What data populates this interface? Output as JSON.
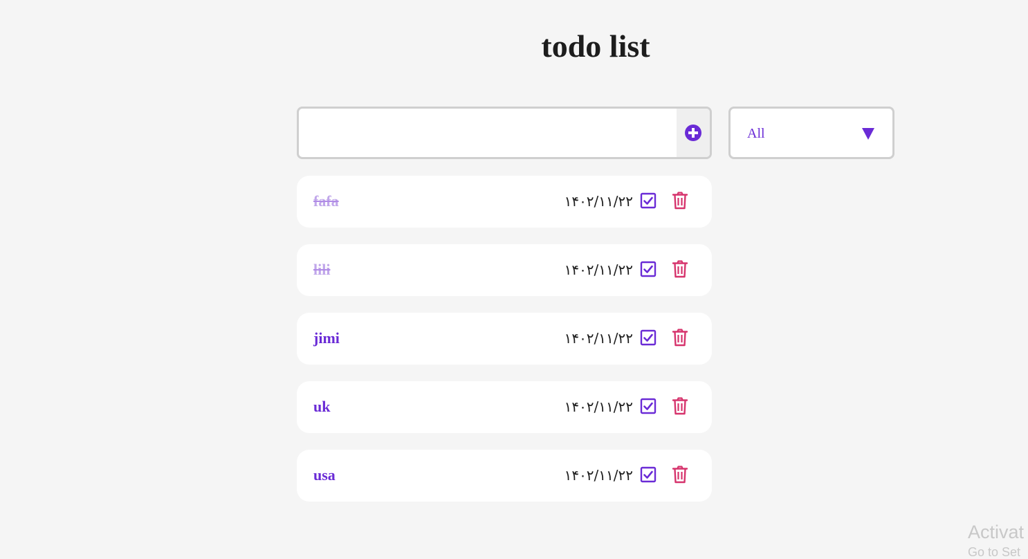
{
  "app": {
    "title": "todo list"
  },
  "form": {
    "input_value": "",
    "input_placeholder": "",
    "add_icon": "plus-circle-icon"
  },
  "filter": {
    "selected": "All",
    "icon": "triangle-down-icon"
  },
  "todos": [
    {
      "text": "fafa",
      "date": "۱۴۰۲/۱۱/۲۲",
      "completed": true
    },
    {
      "text": "lili",
      "date": "۱۴۰۲/۱۱/۲۲",
      "completed": true
    },
    {
      "text": "jimi",
      "date": "۱۴۰۲/۱۱/۲۲",
      "completed": false
    },
    {
      "text": "uk",
      "date": "۱۴۰۲/۱۱/۲۲",
      "completed": false
    },
    {
      "text": "usa",
      "date": "۱۴۰۲/۱۱/۲۲",
      "completed": false
    }
  ],
  "item_icons": {
    "check": "checkbox-checked-icon",
    "delete": "trash-icon"
  },
  "watermark": {
    "title": "Activat",
    "subtitle": "Go to Set"
  },
  "colors": {
    "background": "#f5f5f5",
    "accent": "#6a2bd6",
    "completed_text": "#c0a6ea",
    "delete": "#d6336c",
    "border": "#cfcfcf"
  }
}
